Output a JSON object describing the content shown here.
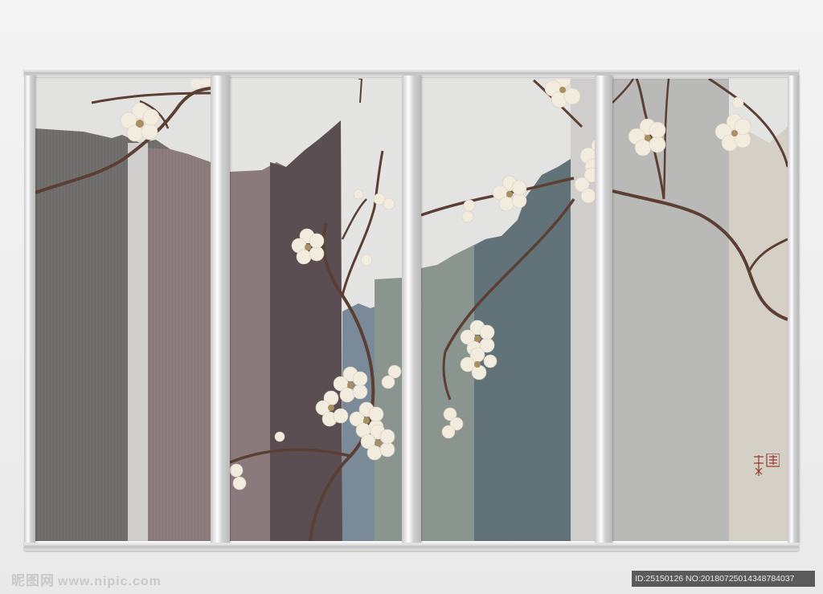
{
  "watermark": {
    "brand": "昵图网",
    "url": "www.nipic.com"
  },
  "image_id": "ID:25150126 NO:20180725014348784037",
  "colors": {
    "frame": "#d6d6d6",
    "background": "#eeeeee",
    "stripe_gray": "#6f6d6b",
    "stripe_mauve": "#8a7a7c",
    "stripe_plum": "#5a4e52",
    "stripe_blue": "#7b8a99",
    "stripe_teal": "#617378",
    "stripe_light": "#c9c9c9",
    "blossom": "#f2ecdf",
    "branch": "#5b3f33",
    "seal": "#9a3a2e"
  },
  "panels": [
    "panel-1",
    "panel-2",
    "panel-3",
    "panel-4"
  ]
}
